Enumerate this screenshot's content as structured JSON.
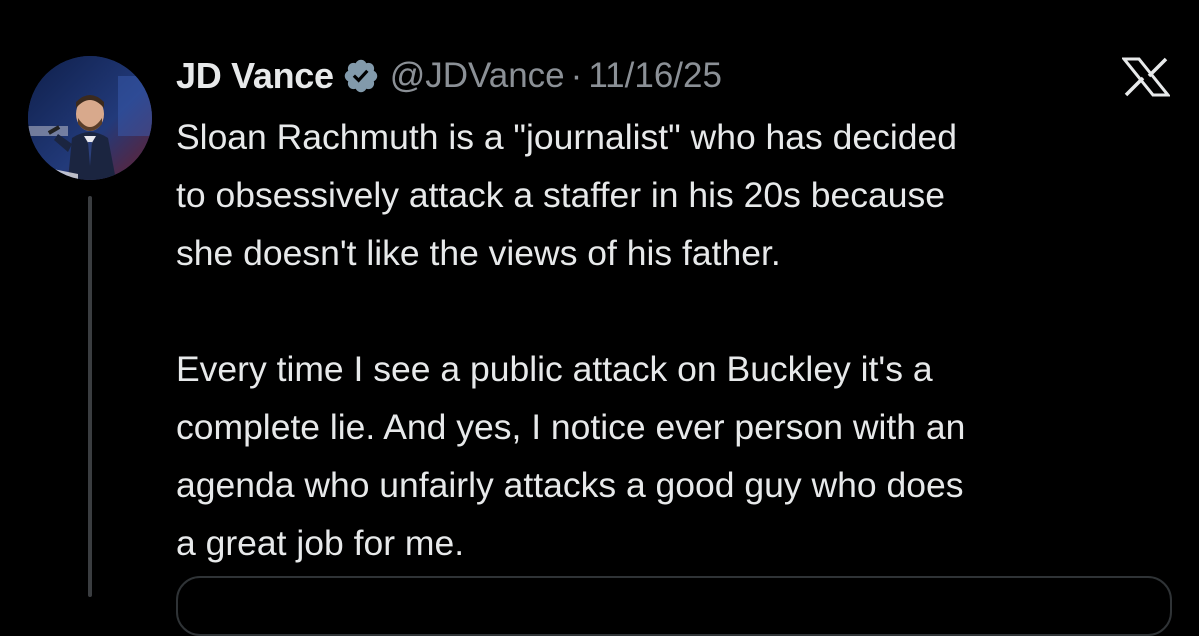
{
  "tweet": {
    "display_name": "JD Vance",
    "handle": "@JDVance",
    "separator": "·",
    "date": "11/16/25",
    "paragraphs": [
      [
        "Sloan Rachmuth is a \"journalist\" who has decided",
        "to obsessively attack a staffer in his 20s because",
        "she doesn't like the views of his father."
      ],
      [
        "Every time I see a public attack on Buckley it's a",
        "complete lie. And yes, I notice ever person with an",
        "agenda who unfairly attacks a good guy who does",
        "a great job for me."
      ]
    ]
  },
  "icons": {
    "verified": "verified-badge-icon",
    "brand": "x-logo-icon",
    "avatar": "avatar-photo"
  },
  "colors": {
    "background": "#000000",
    "primary_text": "#e7e9ea",
    "secondary_text": "#8b9096",
    "verified_badge": "#829aab",
    "thread_line": "#3a3d40"
  }
}
